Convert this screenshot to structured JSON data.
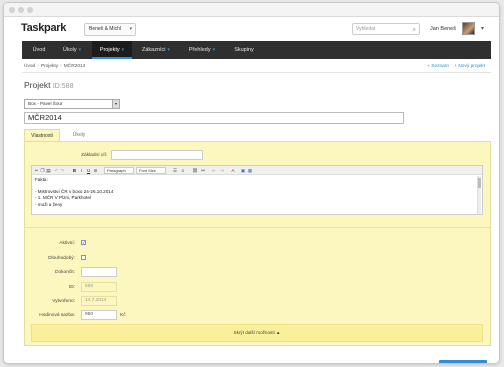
{
  "header": {
    "logo": "Taskpark",
    "company": "Beneš & Michl",
    "search_placeholder": "Vyhledat",
    "user_name": "Jan Beneš"
  },
  "nav": {
    "items": [
      {
        "label": "Úvod",
        "caret": ""
      },
      {
        "label": "Úkoly",
        "caret": "▾"
      },
      {
        "label": "Projekty",
        "caret": "▾"
      },
      {
        "label": "Zákazníci",
        "caret": "▾"
      },
      {
        "label": "Přehledy",
        "caret": "▾"
      },
      {
        "label": "Skupiny",
        "caret": ""
      }
    ],
    "active_index": 2
  },
  "breadcrumb": {
    "items": [
      "Úvod",
      "Projekty",
      "MČR2014"
    ]
  },
  "top_links": {
    "list": "« Seznam",
    "new_project": "+ Nový projekt"
  },
  "page": {
    "title": "Projekt",
    "id_label": "ID:588"
  },
  "form": {
    "owner_select": "Box - Pavel Šour",
    "project_name": "MČR2014",
    "tabs": [
      "Vlastnosti",
      "Úkoly"
    ],
    "active_tab": 0,
    "base_rate_label": "Základní cíl:",
    "base_rate_value": "",
    "editor": {
      "paragraph_select": "Paragraph",
      "font_size_select": "Font Size",
      "lines": [
        "Fakta:",
        "",
        "- Mistrovství ČR v boxu 24-26.10.2014",
        "- 1. MČR V Plzni, Parkhotel",
        "- muži a ženy"
      ]
    },
    "fields": {
      "active_label": "Aktivní:",
      "active_checked": true,
      "long_term_label": "Dlouhodobý:",
      "long_term_checked": false,
      "deadline_label": "Dokončit:",
      "deadline_value": "",
      "id_label": "ID:",
      "id_value": "588",
      "created_label": "Vytvořeno:",
      "created_value": "14.7.2014",
      "hourly_rate_label": "Hodinová sazba:",
      "hourly_rate_value": "950",
      "currency": "Kč"
    },
    "more_options": "Skrýt další možnosti ▲"
  },
  "colors": {
    "accent": "#2d8fd5",
    "nav_bg": "#2f2f2f",
    "panel_bg": "#fcf7bf"
  }
}
